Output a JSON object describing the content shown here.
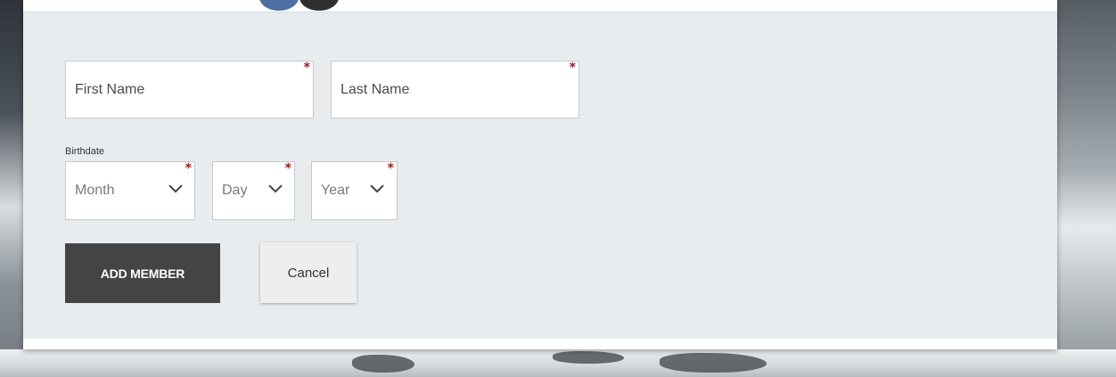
{
  "form": {
    "first_name": {
      "placeholder": "First Name",
      "required_mark": "*"
    },
    "last_name": {
      "placeholder": "Last Name",
      "required_mark": "*"
    },
    "birthdate_label": "Birthdate",
    "month": {
      "value": "Month",
      "required_mark": "*"
    },
    "day": {
      "value": "Day",
      "required_mark": "*"
    },
    "year": {
      "value": "Year",
      "required_mark": "*"
    }
  },
  "actions": {
    "add_label": "ADD MEMBER",
    "cancel_label": "Cancel"
  },
  "colors": {
    "panel_bg": "#e8ecef",
    "primary_button": "#444444",
    "required_star": "#a31b1b"
  }
}
